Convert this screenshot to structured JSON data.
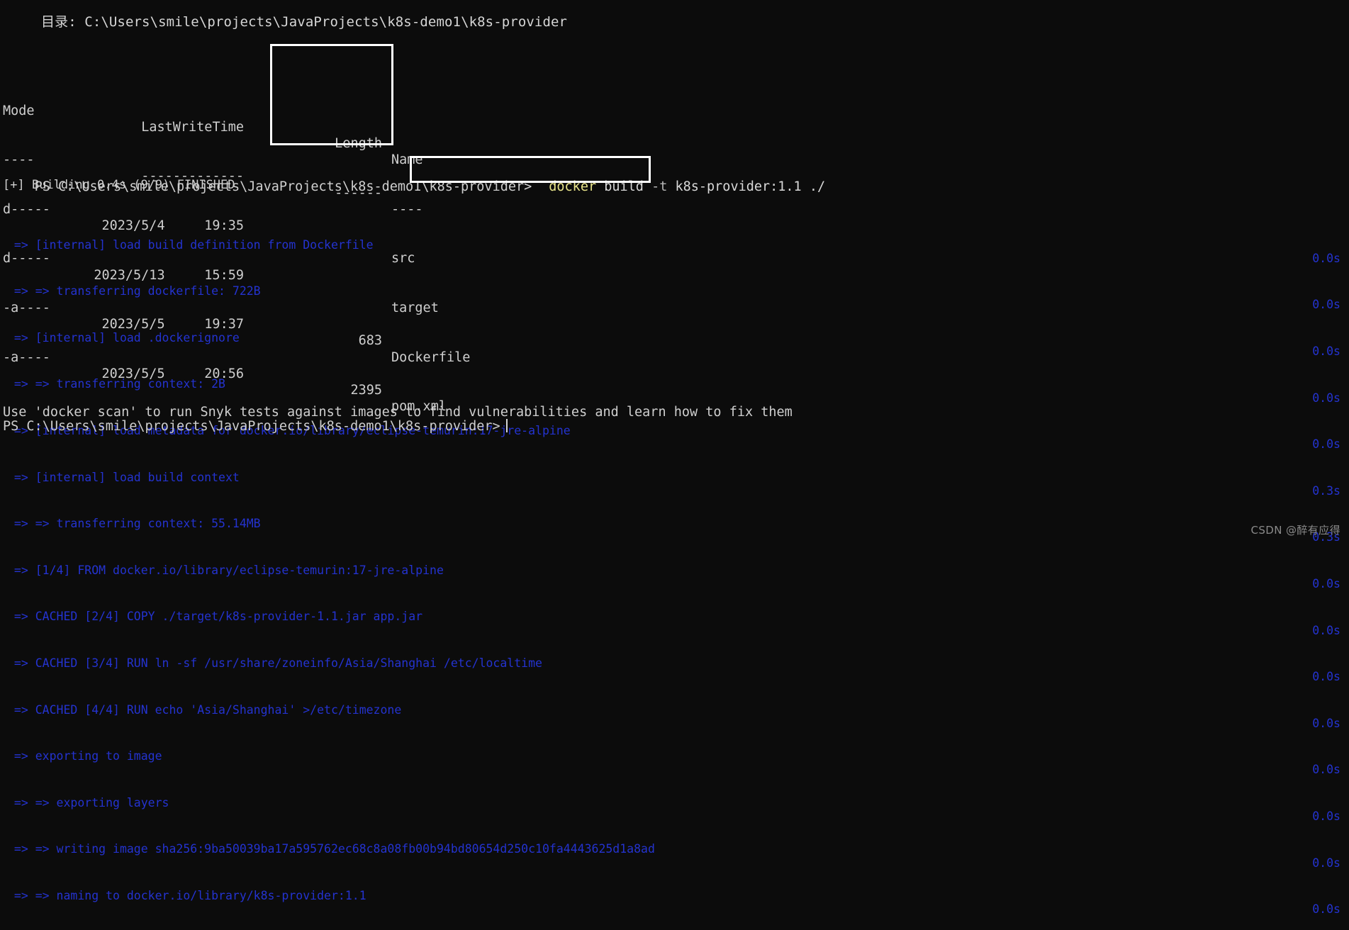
{
  "terminal": {
    "shell": "PowerShell",
    "background_color": "#0c0c0c",
    "foreground_color": "#cccccc",
    "output_color": "#2433d0",
    "command_keyword_color": "#e8e48a",
    "highlight_border_color": "#ffffff"
  },
  "directory_header": {
    "label": "目录: C:\\Users\\smile\\projects\\JavaProjects\\k8s-demo1\\k8s-provider"
  },
  "listing": {
    "headers": {
      "mode": "Mode",
      "last_write_time": "LastWriteTime",
      "length": "Length",
      "name": "Name"
    },
    "separators": {
      "mode": "----",
      "last_write_time": "-------------",
      "length": "------",
      "name": "----"
    },
    "rows": [
      {
        "mode": "d-----",
        "date": "2023/5/4",
        "time": "19:35",
        "length": "",
        "name": "src"
      },
      {
        "mode": "d-----",
        "date": "2023/5/13",
        "time": "15:59",
        "length": "",
        "name": "target"
      },
      {
        "mode": "-a----",
        "date": "2023/5/5",
        "time": "19:37",
        "length": "683",
        "name": "Dockerfile"
      },
      {
        "mode": "-a----",
        "date": "2023/5/5",
        "time": "20:56",
        "length": "2395",
        "name": "pom.xml"
      }
    ]
  },
  "command_prompt": {
    "prompt": "PS C:\\Users\\smile\\projects\\JavaProjects\\k8s-demo1\\k8s-provider>",
    "command_keyword": "docker",
    "command_subcommand": " build ",
    "command_flag": "-t",
    "command_args": " k8s-provider:1.1 ./"
  },
  "build": {
    "status_line": "[+] Building 0.4s (9/9) FINISHED",
    "steps": [
      {
        "text": " => [internal] load build definition from Dockerfile",
        "time": "0.0s"
      },
      {
        "text": " => => transferring dockerfile: 722B",
        "time": "0.0s"
      },
      {
        "text": " => [internal] load .dockerignore",
        "time": "0.0s"
      },
      {
        "text": " => => transferring context: 2B",
        "time": "0.0s"
      },
      {
        "text": " => [internal] load metadata for docker.io/library/eclipse-temurin:17-jre-alpine",
        "time": "0.0s"
      },
      {
        "text": " => [internal] load build context",
        "time": "0.3s"
      },
      {
        "text": " => => transferring context: 55.14MB",
        "time": "0.3s"
      },
      {
        "text": " => [1/4] FROM docker.io/library/eclipse-temurin:17-jre-alpine",
        "time": "0.0s"
      },
      {
        "text": " => CACHED [2/4] COPY ./target/k8s-provider-1.1.jar app.jar",
        "time": "0.0s"
      },
      {
        "text": " => CACHED [3/4] RUN ln -sf /usr/share/zoneinfo/Asia/Shanghai /etc/localtime",
        "time": "0.0s"
      },
      {
        "text": " => CACHED [4/4] RUN echo 'Asia/Shanghai' >/etc/timezone",
        "time": "0.0s"
      },
      {
        "text": " => exporting to image",
        "time": "0.0s"
      },
      {
        "text": " => => exporting layers",
        "time": "0.0s"
      },
      {
        "text": " => => writing image sha256:9ba50039ba17a595762ec68c8a08fb00b94bd80654d250c10fa4443625d1a8ad",
        "time": "0.0s"
      },
      {
        "text": " => => naming to docker.io/library/k8s-provider:1.1",
        "time": "0.0s"
      }
    ]
  },
  "footer": {
    "scan_hint": "Use 'docker scan' to run Snyk tests against images to find vulnerabilities and learn how to fix them",
    "final_prompt": "PS C:\\Users\\smile\\projects\\JavaProjects\\k8s-demo1\\k8s-provider>"
  },
  "watermark": {
    "text": "CSDN @醉有应得"
  }
}
